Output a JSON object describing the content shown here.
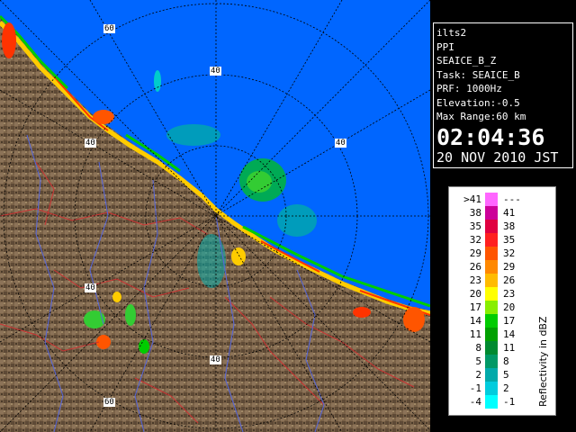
{
  "info_panel": {
    "site": "ilts2",
    "product": "PPI",
    "dataset": "SEAICE_B_Z",
    "task": "Task: SEAICE_B",
    "prf": "PRF: 1000Hz",
    "elevation": "Elevation:-0.5",
    "max_range": "Max Range:60 km",
    "time": "02:04:36",
    "date": "20 NOV 2010 JST"
  },
  "range_rings": {
    "labels": [
      "60",
      "40",
      "40",
      "40",
      "40",
      "40",
      "60"
    ]
  },
  "legend": {
    "title": "Reflectivity in dBZ",
    "rows": [
      {
        "lo": ">41",
        "hi": "---",
        "color": "#ff66ff"
      },
      {
        "lo": "38",
        "hi": "41",
        "color": "#cc0099"
      },
      {
        "lo": "35",
        "hi": "38",
        "color": "#e00040"
      },
      {
        "lo": "32",
        "hi": "35",
        "color": "#ff2020"
      },
      {
        "lo": "29",
        "hi": "32",
        "color": "#ff5500"
      },
      {
        "lo": "26",
        "hi": "29",
        "color": "#ff8800"
      },
      {
        "lo": "23",
        "hi": "26",
        "color": "#ffbb00"
      },
      {
        "lo": "20",
        "hi": "23",
        "color": "#ffff00"
      },
      {
        "lo": "17",
        "hi": "20",
        "color": "#88ee00"
      },
      {
        "lo": "14",
        "hi": "17",
        "color": "#00cc00"
      },
      {
        "lo": "11",
        "hi": "14",
        "color": "#00a000"
      },
      {
        "lo": "8",
        "hi": "11",
        "color": "#008a30"
      },
      {
        "lo": "5",
        "hi": "8",
        "color": "#009966"
      },
      {
        "lo": "2",
        "hi": "5",
        "color": "#00aaaa"
      },
      {
        "lo": "-1",
        "hi": "2",
        "color": "#00ccdd"
      },
      {
        "lo": "-4",
        "hi": "-1",
        "color": "#00ffff"
      }
    ]
  },
  "colors": {
    "sea": "#0066ff",
    "land": "#7a6248",
    "ring": "#000000",
    "boundary_red": "#cc3333",
    "river_blue": "#5566dd"
  }
}
